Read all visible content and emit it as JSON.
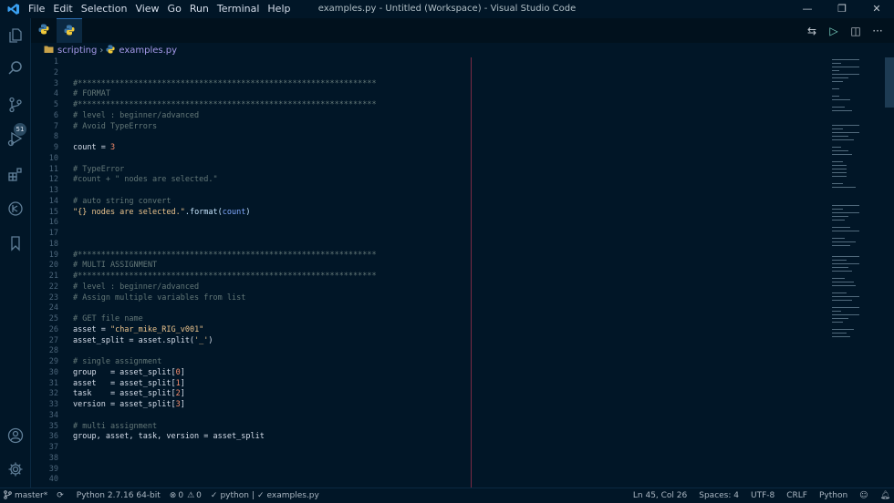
{
  "window": {
    "title": "examples.py - Untitled (Workspace) - Visual Studio Code",
    "menu": [
      "File",
      "Edit",
      "Selection",
      "View",
      "Go",
      "Run",
      "Terminal",
      "Help"
    ],
    "controls": {
      "minimize": "—",
      "maximize": "❐",
      "close": "✕"
    }
  },
  "activity": {
    "source_control_badge": "51"
  },
  "breadcrumb": {
    "folder": "scripting",
    "separator": "›",
    "file": "examples.py"
  },
  "editor_actions": {
    "diff": "⇆",
    "run": "▷",
    "split": "◫",
    "more": "···"
  },
  "editor": {
    "line_numbers": [
      "1",
      "2",
      "3",
      "4",
      "5",
      "6",
      "7",
      "8",
      "9",
      "10",
      "11",
      "12",
      "13",
      "14",
      "15",
      "16",
      "17",
      "18",
      "19",
      "20",
      "21",
      "22",
      "23",
      "24",
      "25",
      "26",
      "27",
      "28",
      "29",
      "30",
      "31",
      "32",
      "33",
      "34",
      "35",
      "36",
      "37",
      "38",
      "39",
      "40"
    ],
    "lines": [
      [],
      [],
      [
        {
          "t": "#****************************************************************",
          "c": "cm"
        }
      ],
      [
        {
          "t": "# FORMAT",
          "c": "cm"
        }
      ],
      [
        {
          "t": "#****************************************************************",
          "c": "cm"
        }
      ],
      [
        {
          "t": "# level : beginner/advanced",
          "c": "cm"
        }
      ],
      [
        {
          "t": "# Avoid TypeErrors",
          "c": "cm"
        }
      ],
      [],
      [
        {
          "t": "count = ",
          "c": "var"
        },
        {
          "t": "3",
          "c": "num"
        }
      ],
      [],
      [
        {
          "t": "# TypeError",
          "c": "cm"
        }
      ],
      [
        {
          "t": "#count + \" nodes are selected.\"",
          "c": "cm"
        }
      ],
      [],
      [
        {
          "t": "# auto string convert",
          "c": "cm"
        }
      ],
      [
        {
          "t": "\"{} nodes are selected.\"",
          "c": "str"
        },
        {
          "t": ".format(",
          "c": "fn"
        },
        {
          "t": "count",
          "c": "arg"
        },
        {
          "t": ")",
          "c": "fn"
        }
      ],
      [],
      [],
      [],
      [
        {
          "t": "#****************************************************************",
          "c": "cm"
        }
      ],
      [
        {
          "t": "# MULTI ASSIGNMENT",
          "c": "cm"
        }
      ],
      [
        {
          "t": "#****************************************************************",
          "c": "cm"
        }
      ],
      [
        {
          "t": "# level : beginner/advanced",
          "c": "cm"
        }
      ],
      [
        {
          "t": "# Assign multiple variables from list",
          "c": "cm"
        }
      ],
      [],
      [
        {
          "t": "# GET file name",
          "c": "cm"
        }
      ],
      [
        {
          "t": "asset = ",
          "c": "var"
        },
        {
          "t": "\"char_mike_RIG_v001\"",
          "c": "str"
        }
      ],
      [
        {
          "t": "asset_split = asset.split(",
          "c": "var"
        },
        {
          "t": "'_'",
          "c": "str"
        },
        {
          "t": ")",
          "c": "var"
        }
      ],
      [],
      [
        {
          "t": "# single assignment",
          "c": "cm"
        }
      ],
      [
        {
          "t": "group   = asset_split[",
          "c": "var"
        },
        {
          "t": "0",
          "c": "num"
        },
        {
          "t": "]",
          "c": "var"
        }
      ],
      [
        {
          "t": "asset   = asset_split[",
          "c": "var"
        },
        {
          "t": "1",
          "c": "num"
        },
        {
          "t": "]",
          "c": "var"
        }
      ],
      [
        {
          "t": "task    = asset_split[",
          "c": "var"
        },
        {
          "t": "2",
          "c": "num"
        },
        {
          "t": "]",
          "c": "var"
        }
      ],
      [
        {
          "t": "version = asset_split[",
          "c": "var"
        },
        {
          "t": "3",
          "c": "num"
        },
        {
          "t": "]",
          "c": "var"
        }
      ],
      [],
      [
        {
          "t": "# multi assignment",
          "c": "cm"
        }
      ],
      [
        {
          "t": "group, asset, task, version = asset_split",
          "c": "var"
        }
      ],
      [],
      [],
      [],
      []
    ]
  },
  "statusbar": {
    "branch": "master*",
    "interpreter": "Python 2.7.16 64-bit",
    "errors": "0",
    "warnings": "0",
    "linter": "python",
    "check_file": "examples.py",
    "cursor": "Ln 45, Col 26",
    "spaces": "Spaces: 4",
    "encoding": "UTF-8",
    "eol": "CRLF",
    "language": "Python"
  },
  "colors": {
    "background": "#011627",
    "accent": "#2b6cb0",
    "ruler": "#7a2a44"
  }
}
